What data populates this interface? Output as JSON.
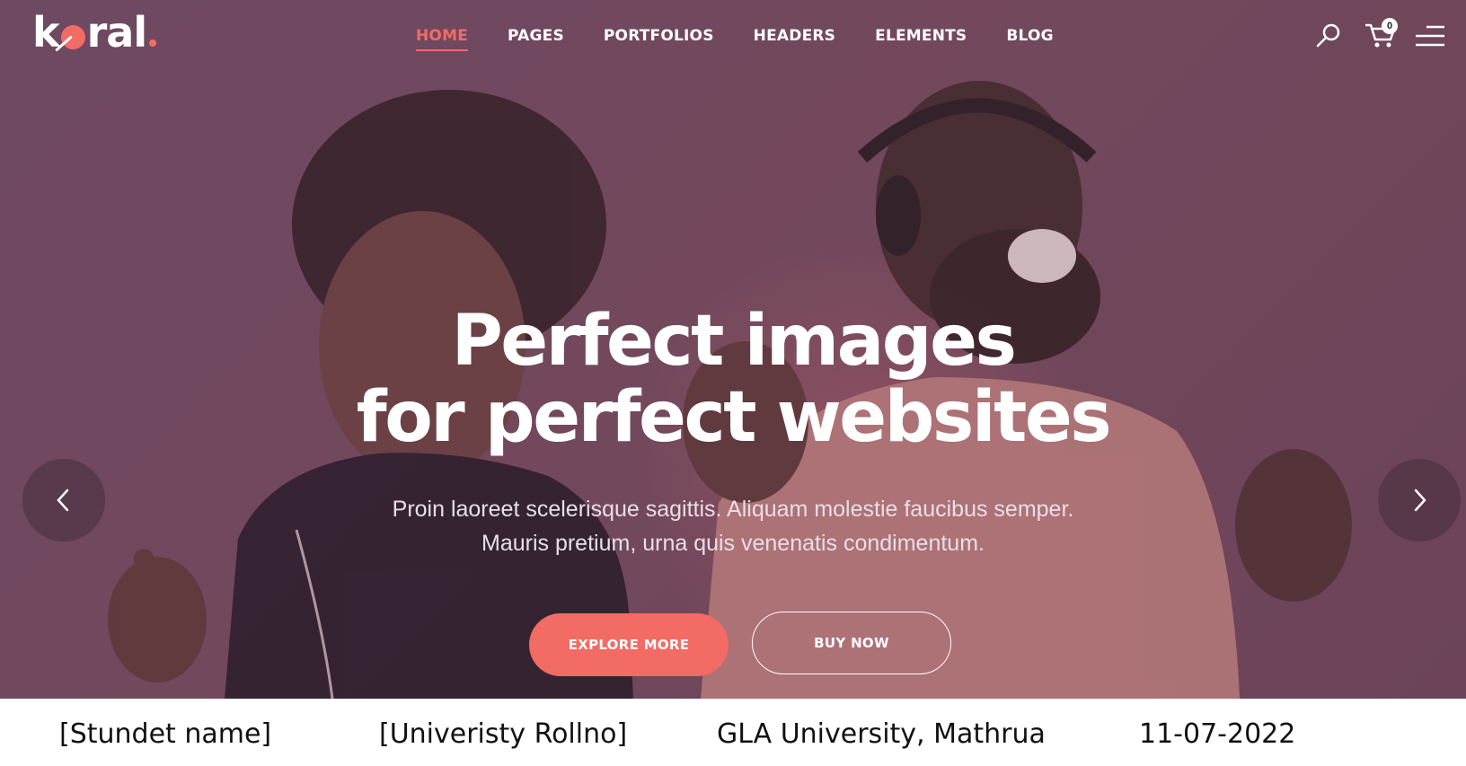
{
  "header": {
    "logo_text_start": "k",
    "logo_text_end": "ral",
    "nav": [
      {
        "label": "HOME",
        "active": true
      },
      {
        "label": "PAGES",
        "active": false
      },
      {
        "label": "PORTFOLIOS",
        "active": false
      },
      {
        "label": "HEADERS",
        "active": false
      },
      {
        "label": "ELEMENTS",
        "active": false
      },
      {
        "label": "BLOG",
        "active": false
      }
    ],
    "cart_count": "0",
    "icons": [
      "search-icon",
      "cart-icon",
      "menu-icon"
    ]
  },
  "hero": {
    "headline_line1": "Perfect images",
    "headline_line2": "for perfect websites",
    "sub_line1": "Proin laoreet scelerisque sagittis. Aliquam molestie faucibus semper.",
    "sub_line2": "Mauris pretium, urna quis venenatis condimentum.",
    "explore_label": "EXPLORE MORE",
    "buy_label": "BUY NOW",
    "prev_icon": "chevron-left-icon",
    "next_icon": "chevron-right-icon"
  },
  "footer": {
    "student_name": "[Stundet name]",
    "roll_no": "[Univeristy Rollno]",
    "university": "GLA University, Mathrua",
    "date": "11-07-2022"
  },
  "colors": {
    "accent": "#f26b64",
    "hero_overlay": "#6e4a63",
    "text_light": "#ffffff"
  }
}
